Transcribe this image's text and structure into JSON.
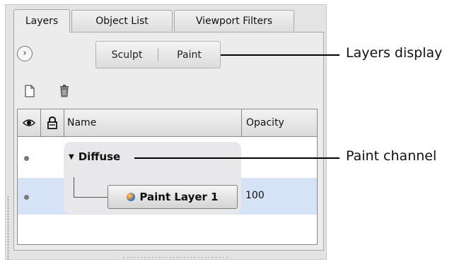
{
  "tabs": [
    {
      "label": "Layers",
      "active": true
    },
    {
      "label": "Object List",
      "active": false
    },
    {
      "label": "Viewport Filters",
      "active": false
    }
  ],
  "expand_icon": "chevron-right-circle-icon",
  "mode_toggle": {
    "sculpt_label": "Sculpt",
    "paint_label": "Paint"
  },
  "toolbar": {
    "new_layer_icon": "new-document-icon",
    "delete_layer_icon": "trash-icon"
  },
  "table": {
    "columns": {
      "visibility_icon": "eye-icon",
      "lock_icon": "lock-icon",
      "name": "Name",
      "opacity": "Opacity"
    },
    "rows": [
      {
        "name": "Diffuse",
        "type": "channel",
        "expanded": true
      },
      {
        "name": "Paint Layer 1",
        "type": "layer",
        "opacity": "100",
        "selected": true
      }
    ]
  },
  "callouts": {
    "layers_display": "Layers display",
    "paint_channel": "Paint channel"
  }
}
